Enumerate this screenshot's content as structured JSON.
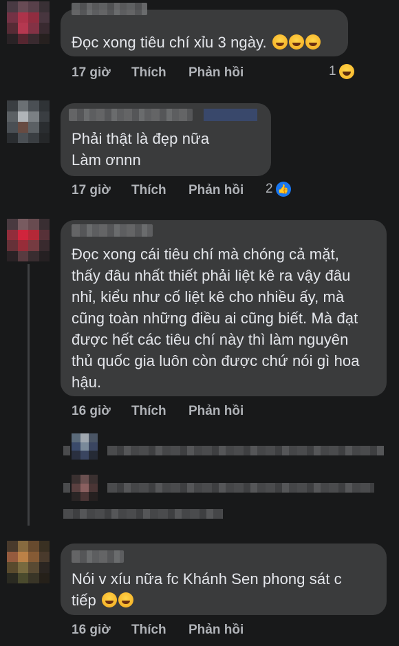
{
  "comments": [
    {
      "text_lines": [
        "Đọc xong tiêu chí xỉu 3 ngày."
      ],
      "inline_emojis": [
        "rofl",
        "rofl",
        "rofl"
      ],
      "time": "17 giờ",
      "like": "Thích",
      "reply": "Phản hồi",
      "reaction_count": "1",
      "reaction_icon": "haha-emoji"
    },
    {
      "text_lines": [
        "Phải thật là đẹp nữa",
        "Làm ơnnn"
      ],
      "time": "17 giờ",
      "like": "Thích",
      "reply": "Phản hồi",
      "reaction_count": "2",
      "reaction_icon": "like-reaction"
    },
    {
      "text_lines": [
        "Đọc xong cái tiêu chí mà chóng cả mặt,",
        "thấy đâu nhất thiết phải liệt kê ra vậy đâu",
        "nhỉ, kiểu như cố liệt kê cho nhiều ấy, mà",
        "cũng toàn những điều ai cũng biết. Mà đạt",
        "được hết các tiêu chí này thì làm nguyên",
        "thủ quốc gia luôn còn được chứ nói gì hoa",
        "hậu."
      ],
      "time": "16 giờ",
      "like": "Thích",
      "reply": "Phản hồi"
    },
    {
      "text_lines": [
        "Nói v xíu nữa fc Khánh Sen phong sát c",
        "tiếp"
      ],
      "inline_emojis": [
        "rofl",
        "zany"
      ],
      "time": "16 giờ",
      "like": "Thích",
      "reply": "Phản hồi"
    }
  ],
  "colors": {
    "background": "#18191a",
    "bubble": "#3a3b3c",
    "text": "#e4e6eb",
    "meta": "#b0b3b8",
    "like_blue": "#1877f2"
  }
}
